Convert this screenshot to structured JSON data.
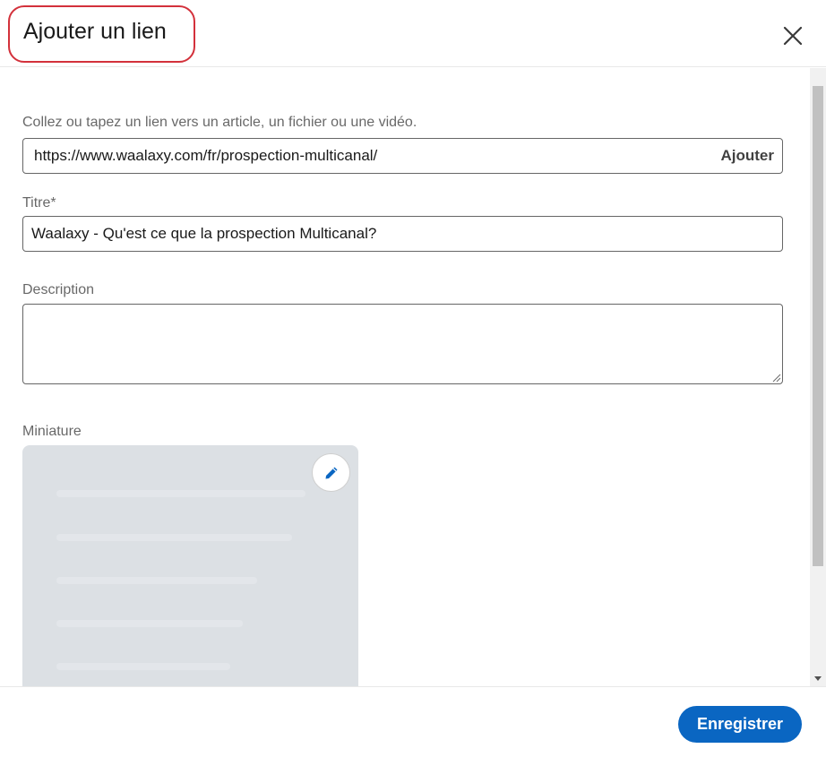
{
  "dialog": {
    "title": "Ajouter un lien",
    "close_icon": "close-icon"
  },
  "link": {
    "label": "Collez ou tapez un lien vers un article, un fichier ou une vidéo.",
    "value": "https://www.waalaxy.com/fr/prospection-multicanal/",
    "add_label": "Ajouter"
  },
  "title_field": {
    "label": "Titre*",
    "value": "Waalaxy - Qu'est ce que la prospection Multicanal?"
  },
  "description": {
    "label": "Description",
    "value": ""
  },
  "thumbnail": {
    "label": "Miniature",
    "edit_icon": "pencil-icon"
  },
  "footer": {
    "save_label": "Enregistrer"
  },
  "colors": {
    "primary": "#0a66c2",
    "highlight": "#d3313b",
    "thumbnail_bg": "#dce0e4"
  }
}
